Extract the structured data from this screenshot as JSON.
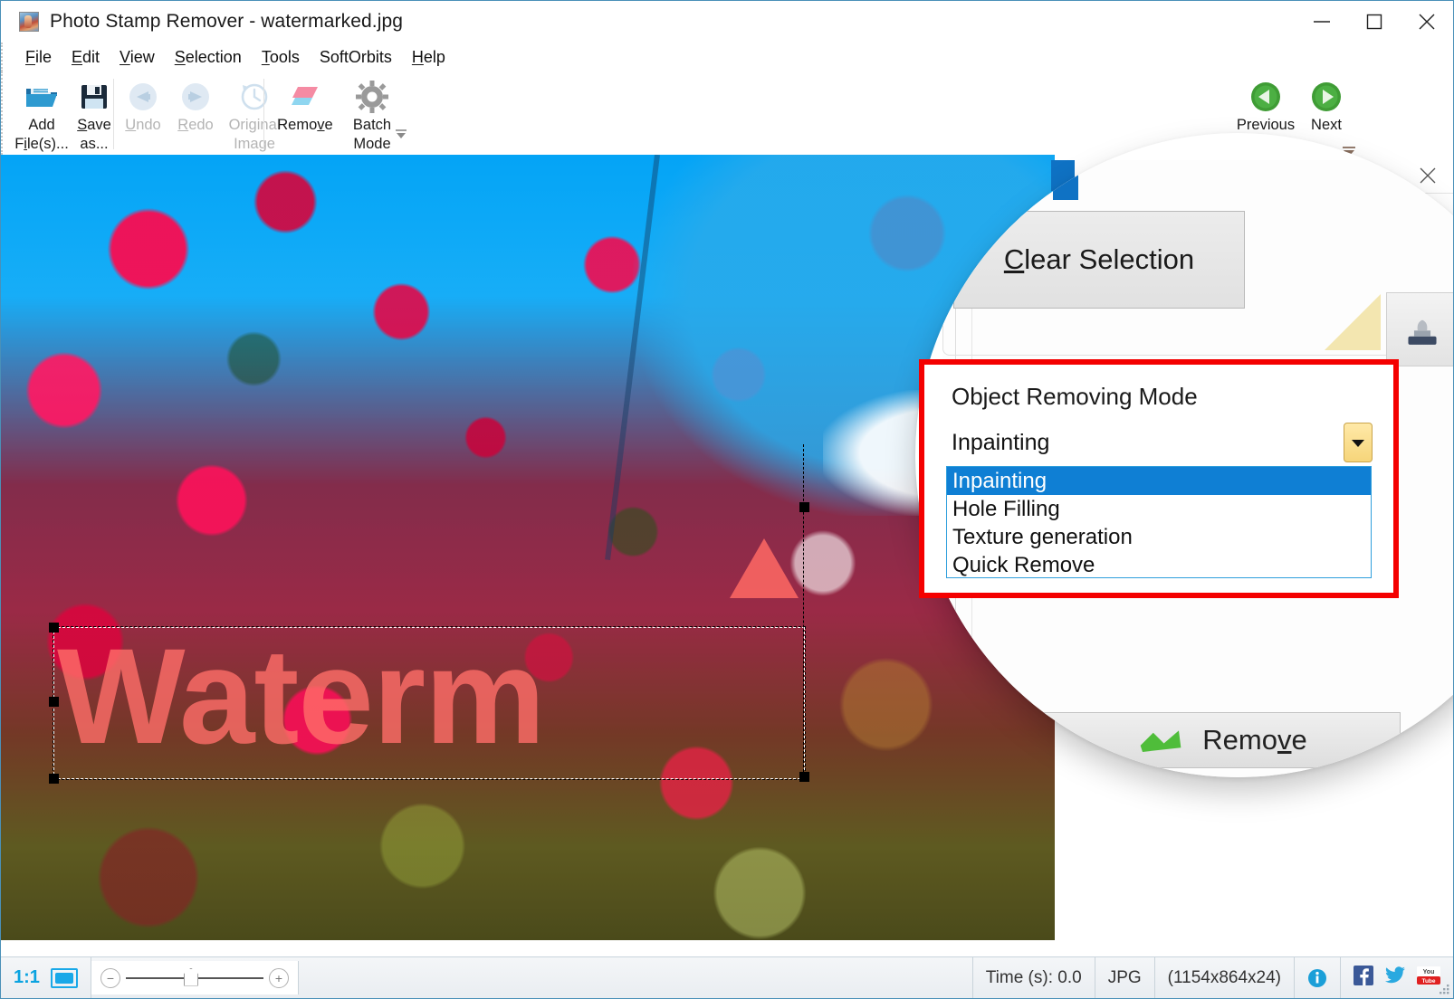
{
  "window": {
    "title": "Photo Stamp Remover - watermarked.jpg",
    "app_icon": "photo-stamp-remover-icon",
    "controls": {
      "minimize": "minimize-icon",
      "maximize": "maximize-icon",
      "close": "close-icon"
    }
  },
  "menubar": {
    "items": [
      {
        "label": "File",
        "accel": "F"
      },
      {
        "label": "Edit",
        "accel": "E"
      },
      {
        "label": "View",
        "accel": "V"
      },
      {
        "label": "Selection",
        "accel": "S"
      },
      {
        "label": "Tools",
        "accel": "T"
      },
      {
        "label": "SoftOrbits",
        "accel": ""
      },
      {
        "label": "Help",
        "accel": "H"
      }
    ]
  },
  "toolbar": {
    "buttons": [
      {
        "id": "add-files",
        "line1": "Add",
        "line2": "File(s)...",
        "icon": "open-folder-icon",
        "enabled": true
      },
      {
        "id": "save-as",
        "line1": "Save",
        "line2": "as...",
        "icon": "floppy-save-icon",
        "enabled": true
      },
      {
        "id": "undo",
        "line1": "Undo",
        "line2": "",
        "icon": "undo-arrow-icon",
        "enabled": false
      },
      {
        "id": "redo",
        "line1": "Redo",
        "line2": "",
        "icon": "redo-arrow-icon",
        "enabled": false
      },
      {
        "id": "original-image",
        "line1": "Original",
        "line2": "Image",
        "icon": "clock-history-icon",
        "enabled": false
      },
      {
        "id": "remove",
        "line1": "Remove",
        "line2": "",
        "icon": "eraser-icon",
        "enabled": true
      },
      {
        "id": "batch-mode",
        "line1": "Batch",
        "line2": "Mode",
        "icon": "gear-icon",
        "enabled": true
      }
    ],
    "nav": [
      {
        "id": "previous",
        "label": "Previous",
        "icon": "green-left-arrow-icon"
      },
      {
        "id": "next",
        "label": "Next",
        "icon": "green-right-arrow-icon"
      }
    ],
    "overflow_icon": "overflow-caret-icon"
  },
  "canvas": {
    "watermark_text": "Waterm",
    "selection_label": "selection-marquee",
    "image_alt": "pink crabapple blossoms against blue sky"
  },
  "panel": {
    "close_icon": "close-icon",
    "clear_selection_label": "Clear Selection",
    "clear_selection_accel": "C",
    "remove_button_label": "Remove",
    "remove_button_accel": "v",
    "stamp_tool_icon": "rubber-stamp-icon",
    "note_icon": "yellow-note-icon",
    "scrollbar_thumb": "vertical-scrollbar-thumb"
  },
  "callout": {
    "border_color": "#f40000",
    "title": "Object Removing Mode",
    "combo_value": "Inpainting",
    "combo_arrow_icon": "chevron-down-icon",
    "options": [
      {
        "label": "Inpainting",
        "selected": true
      },
      {
        "label": "Hole Filling",
        "selected": false
      },
      {
        "label": "Texture generation",
        "selected": false
      },
      {
        "label": "Quick Remove",
        "selected": false
      }
    ],
    "highlight_color": "#0f7fd4"
  },
  "statusbar": {
    "zoom_ratio": "1:1",
    "selection_icon": "selection-mode-icon",
    "zoom_out_icon": "zoom-out-icon",
    "zoom_in_icon": "zoom-in-icon",
    "time_label": "Time (s): 0.0",
    "format_label": "JPG",
    "dimensions_label": "(1154x864x24)",
    "info_icon": "info-icon",
    "facebook_icon": "facebook-icon",
    "twitter_icon": "twitter-icon",
    "youtube_icon": "youtube-icon",
    "resize_grip": "resize-grip-icon"
  }
}
